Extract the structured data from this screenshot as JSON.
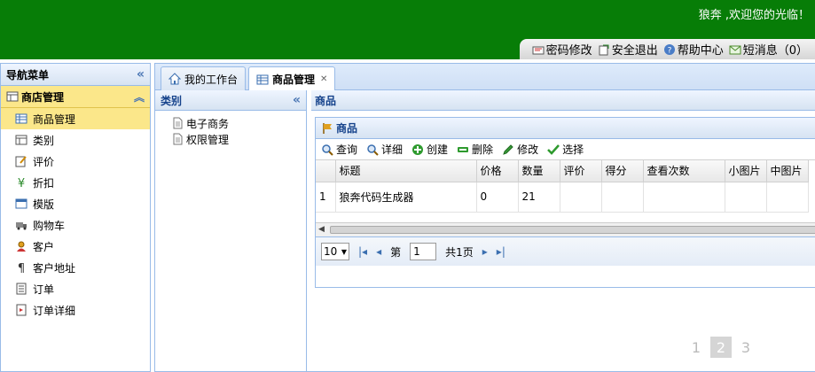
{
  "header": {
    "welcome": "狼奔 ,欢迎您的光临！",
    "links": [
      {
        "label": "密码修改",
        "icon": "password-icon"
      },
      {
        "label": "安全退出",
        "icon": "logout-icon"
      },
      {
        "label": "帮助中心",
        "icon": "help-icon"
      },
      {
        "label": "短消息（0）",
        "icon": "message-icon"
      }
    ]
  },
  "nav": {
    "title": "导航菜单",
    "group": "商店管理",
    "items": [
      {
        "label": "商品管理"
      },
      {
        "label": "类别"
      },
      {
        "label": "评价"
      },
      {
        "label": "折扣"
      },
      {
        "label": "模版"
      },
      {
        "label": "购物车"
      },
      {
        "label": "客户"
      },
      {
        "label": "客户地址"
      },
      {
        "label": "订单"
      },
      {
        "label": "订单详细"
      }
    ]
  },
  "tabs": [
    {
      "label": "我的工作台"
    },
    {
      "label": "商品管理"
    }
  ],
  "category": {
    "title": "类别",
    "items": [
      "电子商务",
      "权限管理"
    ]
  },
  "product": {
    "panel_title": "商品",
    "grid_title": "商品",
    "toolbar": [
      "查询",
      "详细",
      "创建",
      "删除",
      "修改",
      "选择"
    ],
    "columns": [
      "标题",
      "价格",
      "数量",
      "评价",
      "得分",
      "查看次数",
      "小图片",
      "中图片"
    ],
    "rows": [
      {
        "num": "1",
        "cells": [
          "狼奔代码生成器",
          "0",
          "21",
          "",
          "",
          "",
          "",
          ""
        ]
      }
    ],
    "pager": {
      "page_size": "10",
      "prefix": "第",
      "current": "1",
      "suffix": "共1页"
    }
  },
  "pages": [
    "1",
    "2",
    "3"
  ],
  "colors": {
    "header_bg": "#077d07",
    "accent": "#99bbe8",
    "selected": "#fbe78a"
  }
}
